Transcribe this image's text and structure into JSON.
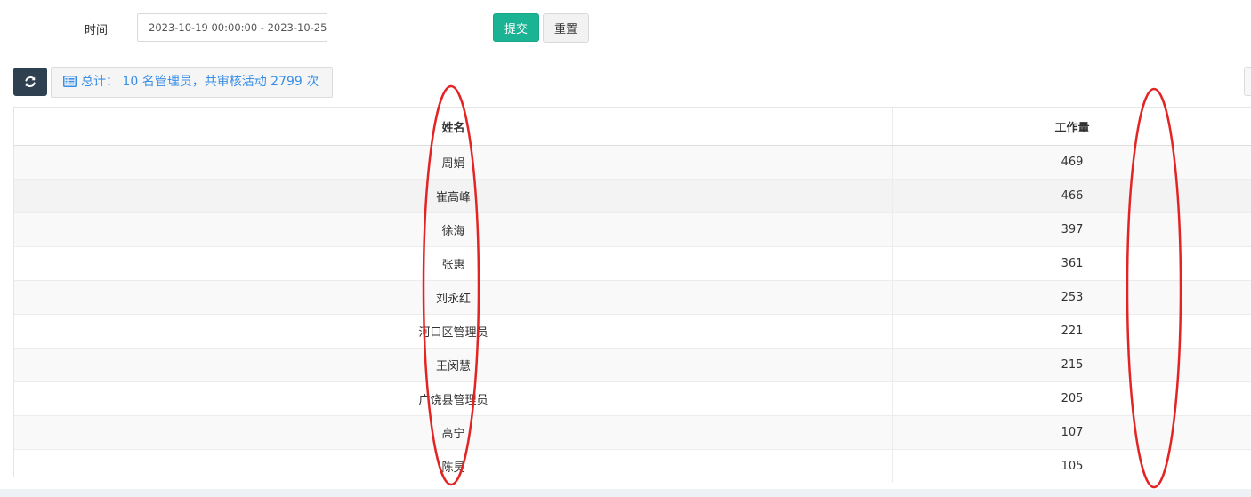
{
  "filter": {
    "time_label": "时间",
    "time_value": "2023-10-19 00:00:00 - 2023-10-25",
    "submit_label": "提交",
    "reset_label": "重置"
  },
  "toolbar": {
    "summary_text": "总计： 10 名管理员，共审核活动 2799 次"
  },
  "table": {
    "headers": {
      "name": "姓名",
      "workload": "工作量"
    },
    "rows": [
      {
        "name": "周娟",
        "workload": "469"
      },
      {
        "name": "崔高峰",
        "workload": "466"
      },
      {
        "name": "徐海",
        "workload": "397"
      },
      {
        "name": "张惠",
        "workload": "361"
      },
      {
        "name": "刘永红",
        "workload": "253"
      },
      {
        "name": "河口区管理员",
        "workload": "221"
      },
      {
        "name": "王闵慧",
        "workload": "215"
      },
      {
        "name": "广饶县管理员",
        "workload": "205"
      },
      {
        "name": "高宁",
        "workload": "107"
      },
      {
        "name": "陈昊",
        "workload": "105"
      }
    ]
  },
  "colors": {
    "accent_green": "#1ab394",
    "dark_navy": "#2f4050",
    "info_blue": "#3a8ee6",
    "annotation_red": "#e32424"
  },
  "icons": {
    "refresh": "refresh-icon",
    "summary": "list-icon"
  }
}
